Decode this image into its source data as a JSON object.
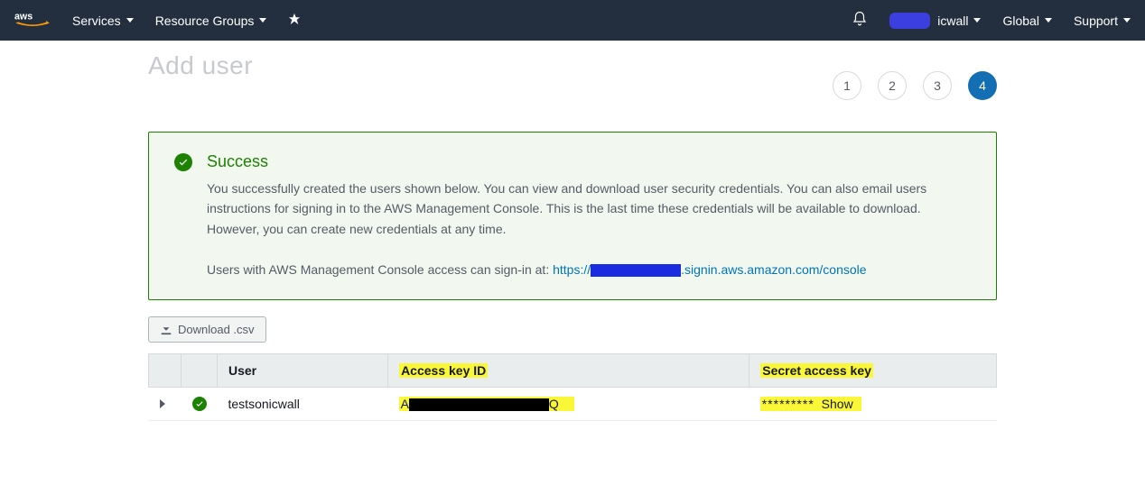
{
  "nav": {
    "services": "Services",
    "resource_groups": "Resource Groups",
    "username_suffix": "icwall",
    "region": "Global",
    "support": "Support"
  },
  "page": {
    "title": "Add user"
  },
  "steps": {
    "s1": "1",
    "s2": "2",
    "s3": "3",
    "s4": "4"
  },
  "success": {
    "title": "Success",
    "body": "You successfully created the users shown below. You can view and download user security credentials. You can also email users instructions for signing in to the AWS Management Console. This is the last time these credentials will be available to download. However, you can create new credentials at any time.",
    "signin_prefix": "Users with AWS Management Console access can sign-in at: ",
    "signin_url_pre": "https://",
    "signin_url_post": ".signin.aws.amazon.com/console"
  },
  "buttons": {
    "download_csv": "Download .csv"
  },
  "table": {
    "headers": {
      "user": "User",
      "access_key": "Access key ID",
      "secret": "Secret access key"
    },
    "rows": [
      {
        "user": "testsonicwall",
        "access_key_prefix": "A",
        "access_key_suffix": "Q",
        "secret_masked": "*********",
        "show_label": "Show"
      }
    ]
  }
}
